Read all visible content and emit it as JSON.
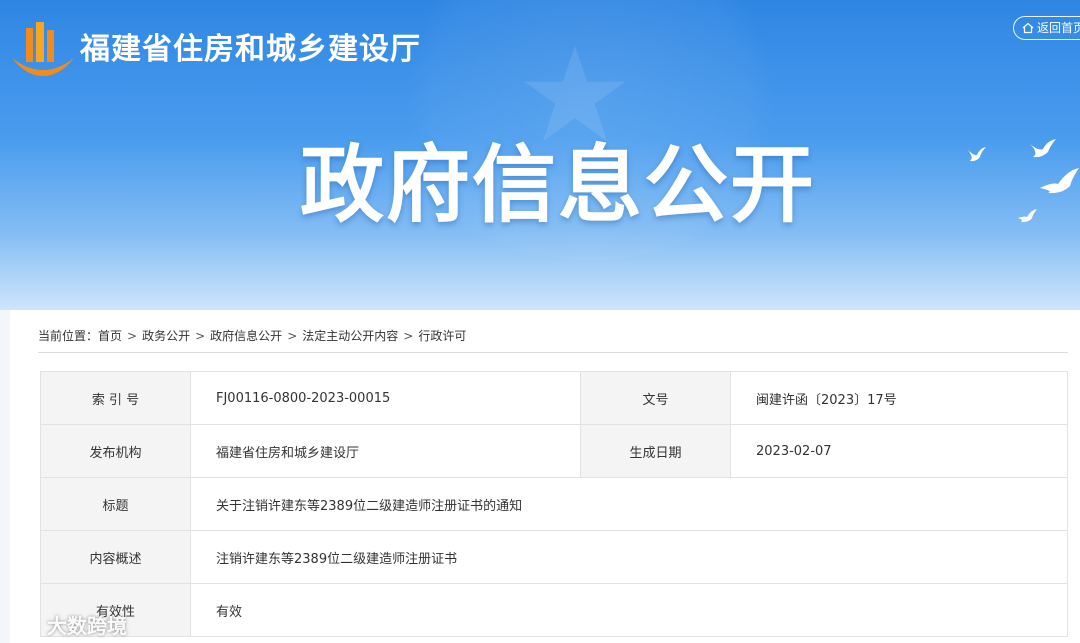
{
  "header": {
    "site_title": "福建省住房和城乡建设厅",
    "back_home": "返回首页",
    "hero_title": "政府信息公开"
  },
  "breadcrumb": {
    "prefix": "当前位置：",
    "items": [
      "首页",
      "政务公开",
      "政府信息公开",
      "法定主动公开内容",
      "行政许可"
    ],
    "separator": ">"
  },
  "info_table": {
    "rows": [
      {
        "label": "索 引 号",
        "value": "FJ00116-0800-2023-00015",
        "label2": "文号",
        "value2": "闽建许函〔2023〕17号"
      },
      {
        "label": "发布机构",
        "value": "福建省住房和城乡建设厅",
        "label2": "生成日期",
        "value2": "2023-02-07"
      },
      {
        "label": "标题",
        "value": "关于注销许建东等2389位二级建造师注册证书的通知"
      },
      {
        "label": "内容概述",
        "value": "注销许建东等2389位二级建造师注册证书"
      },
      {
        "label": "有效性",
        "value": "有效"
      }
    ]
  },
  "watermark": {
    "text": "大数跨境"
  },
  "colors": {
    "banner_blue": "#2f86e3",
    "logo_orange": "#f08c1e",
    "table_label_bg": "#f4f4f4"
  }
}
